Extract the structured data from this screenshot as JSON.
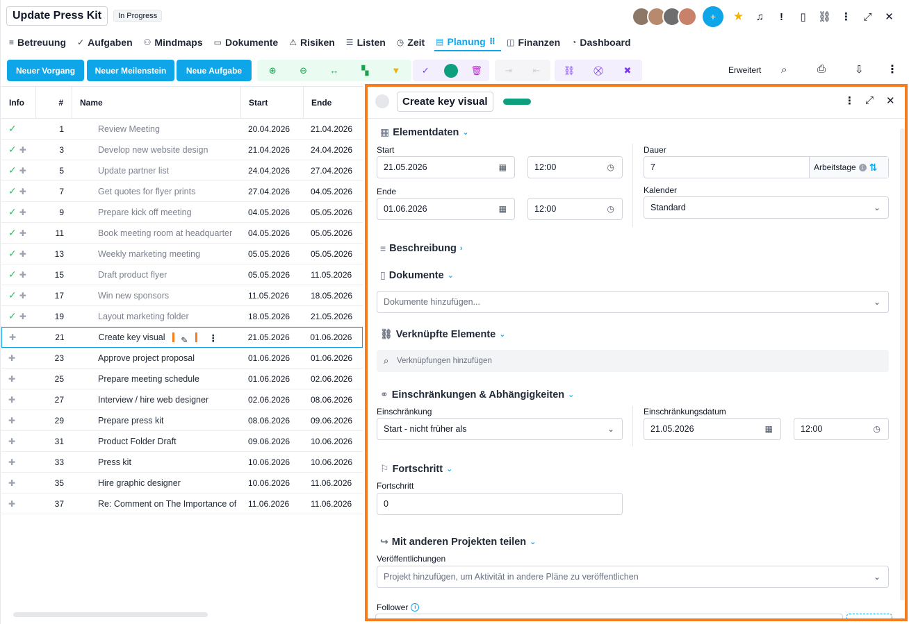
{
  "header": {
    "title": "Update Press Kit",
    "status": "In Progress",
    "avatars": [
      "",
      "",
      "",
      ""
    ]
  },
  "tabs": [
    {
      "icon": "sliders-icon",
      "glyph": "≡",
      "label": "Betreuung"
    },
    {
      "icon": "check-circle-icon",
      "glyph": "✓",
      "label": "Aufgaben"
    },
    {
      "icon": "mindmap-icon",
      "glyph": "⚇",
      "label": "Mindmaps"
    },
    {
      "icon": "folder-icon",
      "glyph": "▭",
      "label": "Dokumente"
    },
    {
      "icon": "warning-icon",
      "glyph": "⚠",
      "label": "Risiken"
    },
    {
      "icon": "list-icon",
      "glyph": "☰",
      "label": "Listen"
    },
    {
      "icon": "clock-icon",
      "glyph": "◷",
      "label": "Zeit"
    },
    {
      "icon": "gantt-icon",
      "glyph": "▤",
      "label": "Planung"
    },
    {
      "icon": "finance-icon",
      "glyph": "◫",
      "label": "Finanzen"
    },
    {
      "icon": "dashboard-icon",
      "glyph": "◔",
      "label": "Dashboard"
    }
  ],
  "toolbar": {
    "new_process": "Neuer Vorgang",
    "new_milestone": "Neuer Meilenstein",
    "new_task": "Neue Aufgabe",
    "advanced": "Erweitert"
  },
  "grid": {
    "headers": {
      "info": "Info",
      "num": "#",
      "name": "Name",
      "start": "Start",
      "end": "Ende"
    },
    "rows": [
      {
        "done": true,
        "pin": false,
        "num": "1",
        "name": "Review Meeting",
        "start": "20.04.2026",
        "end": "21.04.2026"
      },
      {
        "done": true,
        "pin": true,
        "num": "3",
        "name": "Develop new website design",
        "start": "21.04.2026",
        "end": "24.04.2026"
      },
      {
        "done": true,
        "pin": true,
        "num": "5",
        "name": "Update partner list",
        "start": "24.04.2026",
        "end": "27.04.2026"
      },
      {
        "done": true,
        "pin": true,
        "num": "7",
        "name": "Get quotes for flyer prints",
        "start": "27.04.2026",
        "end": "04.05.2026"
      },
      {
        "done": true,
        "pin": true,
        "num": "9",
        "name": "Prepare kick off meeting",
        "start": "04.05.2026",
        "end": "05.05.2026"
      },
      {
        "done": true,
        "pin": true,
        "num": "11",
        "name": "Book meeting room at headquarter",
        "start": "04.05.2026",
        "end": "05.05.2026"
      },
      {
        "done": true,
        "pin": true,
        "num": "13",
        "name": "Weekly marketing meeting",
        "start": "05.05.2026",
        "end": "05.05.2026"
      },
      {
        "done": true,
        "pin": true,
        "num": "15",
        "name": "Draft product flyer",
        "start": "05.05.2026",
        "end": "11.05.2026"
      },
      {
        "done": true,
        "pin": true,
        "num": "17",
        "name": "Win new sponsors",
        "start": "11.05.2026",
        "end": "18.05.2026"
      },
      {
        "done": true,
        "pin": true,
        "num": "19",
        "name": "Layout marketing folder",
        "start": "18.05.2026",
        "end": "21.05.2026"
      },
      {
        "done": false,
        "pin": true,
        "num": "21",
        "name": "Create key visual",
        "start": "21.05.2026",
        "end": "01.06.2026",
        "selected": true
      },
      {
        "done": false,
        "pin": true,
        "num": "23",
        "name": "Approve project proposal",
        "start": "01.06.2026",
        "end": "01.06.2026"
      },
      {
        "done": false,
        "pin": true,
        "num": "25",
        "name": "Prepare meeting schedule",
        "start": "01.06.2026",
        "end": "02.06.2026"
      },
      {
        "done": false,
        "pin": true,
        "num": "27",
        "name": "Interview / hire web designer",
        "start": "02.06.2026",
        "end": "08.06.2026"
      },
      {
        "done": false,
        "pin": true,
        "num": "29",
        "name": "Prepare press kit",
        "start": "08.06.2026",
        "end": "09.06.2026"
      },
      {
        "done": false,
        "pin": true,
        "num": "31",
        "name": "Product Folder Draft",
        "start": "09.06.2026",
        "end": "10.06.2026"
      },
      {
        "done": false,
        "pin": true,
        "num": "33",
        "name": "Press kit",
        "start": "10.06.2026",
        "end": "10.06.2026"
      },
      {
        "done": false,
        "pin": true,
        "num": "35",
        "name": "Hire graphic designer",
        "start": "10.06.2026",
        "end": "11.06.2026"
      },
      {
        "done": false,
        "pin": true,
        "num": "37",
        "name": "Re: Comment on The Importance of",
        "start": "11.06.2026",
        "end": "11.06.2026"
      }
    ]
  },
  "panel": {
    "title": "Create key visual",
    "sections": {
      "element_data": "Elementdaten",
      "description": "Beschreibung",
      "documents": "Dokumente",
      "linked": "Verknüpfte Elemente",
      "constraints": "Einschränkungen & Abhängigkeiten",
      "progress": "Fortschritt",
      "share": "Mit anderen Projekten teilen"
    },
    "start_label": "Start",
    "start_date": "21.05.2026",
    "start_time": "12:00",
    "end_label": "Ende",
    "end_date": "01.06.2026",
    "end_time": "12:00",
    "duration_label": "Dauer",
    "duration_value": "7",
    "duration_unit": "Arbeitstage",
    "calendar_label": "Kalender",
    "calendar_value": "Standard",
    "documents_placeholder": "Dokumente hinzufügen...",
    "links_placeholder": "Verknüpfungen hinzufügen",
    "constraint_label": "Einschränkung",
    "constraint_value": "Start - nicht früher als",
    "constraint_date_label": "Einschränkungsdatum",
    "constraint_date": "21.05.2026",
    "constraint_time": "12:00",
    "progress_label": "Fortschritt",
    "progress_value": "0",
    "publications_label": "Veröffentlichungen",
    "publications_placeholder": "Projekt hinzufügen, um Aktivität in andere Pläne zu veröffentlichen",
    "follower_label": "Follower"
  }
}
